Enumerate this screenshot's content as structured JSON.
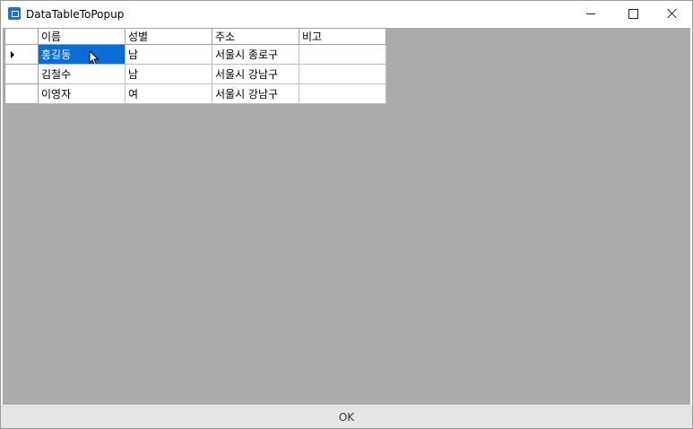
{
  "window": {
    "title": "DataTableToPopup"
  },
  "grid": {
    "columns": [
      "이름",
      "성별",
      "주소",
      "비고"
    ],
    "rows": [
      [
        "홍길동",
        "남",
        "서울시 종로구",
        ""
      ],
      [
        "김철수",
        "남",
        "서울시 강남구",
        ""
      ],
      [
        "이영자",
        "여",
        "서울시 강남구",
        ""
      ]
    ],
    "selected_row": 0,
    "selected_col": 0
  },
  "footer": {
    "ok_label": "OK"
  },
  "colors": {
    "selection": "#0a6cd6",
    "grid_background": "#ababab"
  }
}
